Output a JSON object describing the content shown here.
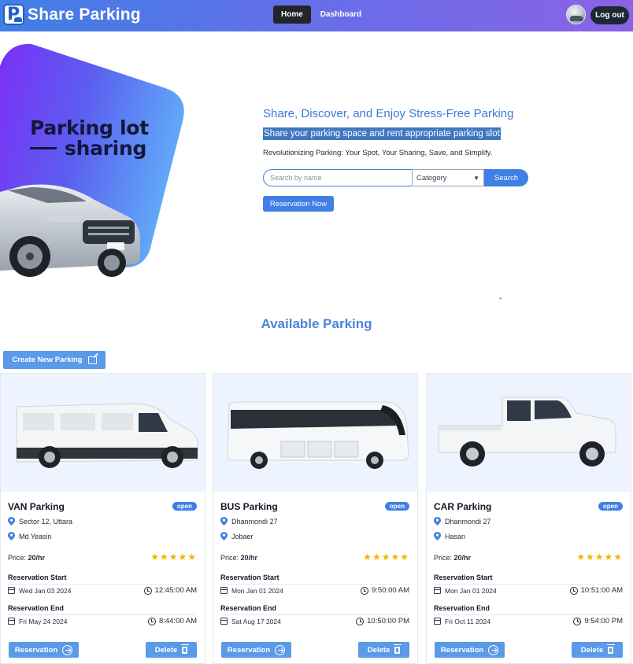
{
  "navbar": {
    "brand": "Share Parking",
    "links": [
      {
        "label": "Home",
        "active": true
      },
      {
        "label": "Dashboard",
        "active": false
      }
    ],
    "logout_label": "Log out"
  },
  "hero": {
    "graphic_line1": "Parking lot",
    "graphic_line2": "sharing",
    "heading": "Share, Discover, and Enjoy Stress-Free Parking",
    "highlight": "Share your parking space and rent appropriate parking slot",
    "subtitle": "Revolutionizing Parking: Your Spot, Your Sharing, Save, and Simplify.",
    "search_placeholder": "Search by name",
    "category_selected": "Category",
    "search_label": "Search",
    "reserve_label": "Reservation Now",
    "stray_mark": "-"
  },
  "section": {
    "title": "Available Parking",
    "create_label": "Create New Parking"
  },
  "labels": {
    "price_prefix": "Price:",
    "reservation_start": "Reservation Start",
    "reservation_end": "Reservation End",
    "reservation_button": "Reservation",
    "delete_button": "Delete"
  },
  "colors": {
    "accent": "#3f7fe6",
    "button": "#5a9ae8",
    "star": "#f5b301",
    "section_title": "#4a86d8"
  },
  "cards": [
    {
      "title": "VAN Parking",
      "status": "open",
      "location": "Sector 12, Uttara",
      "owner": "Md Yeasin",
      "price": "20/hr",
      "rating": 5,
      "stars": "★★★★★",
      "start_date": "Wed Jan 03 2024",
      "start_time": "12:45:00 AM",
      "end_date": "Fri May 24 2024",
      "end_time": "8:44:00 AM",
      "vehicle_icon": "van-image"
    },
    {
      "title": "BUS Parking",
      "status": "open",
      "location": "Dhanmondi 27",
      "owner": "Jobaer",
      "price": "20/hr",
      "rating": 5,
      "stars": "★★★★★",
      "start_date": "Mon Jan 01 2024",
      "start_time": "9:50:00 AM",
      "end_date": "Sat Aug 17 2024",
      "end_time": "10:50:00 PM",
      "vehicle_icon": "bus-image"
    },
    {
      "title": "CAR Parking",
      "status": "open",
      "location": "Dhanmondi 27",
      "owner": "Hasan",
      "price": "20/hr",
      "rating": 5,
      "stars": "★★★★★",
      "start_date": "Mon Jan 01 2024",
      "start_time": "10:51:00 AM",
      "end_date": "Fri Oct 11 2024",
      "end_time": "9:54:00 PM",
      "vehicle_icon": "pickup-truck-image"
    }
  ]
}
